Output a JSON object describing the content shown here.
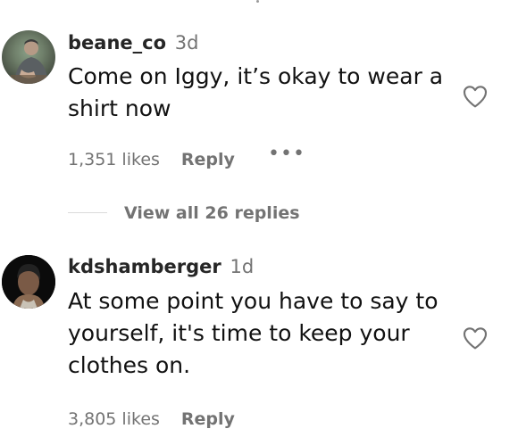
{
  "comments": [
    {
      "username": "beane_co",
      "time": "3d",
      "text": "Come on Iggy, it’s okay to wear a shirt now",
      "likes": "1,351 likes",
      "reply": "Reply",
      "more_icon": "more-horizontal-icon",
      "heart_icon": "heart-outline-icon",
      "view_replies": "View all 26 replies"
    },
    {
      "username": "kdshamberger",
      "time": "1d",
      "text": "At some point you have to say to yourself, it's time to keep your clothes on.",
      "likes": "3,805 likes",
      "reply": "Reply",
      "heart_icon": "heart-outline-icon"
    }
  ]
}
